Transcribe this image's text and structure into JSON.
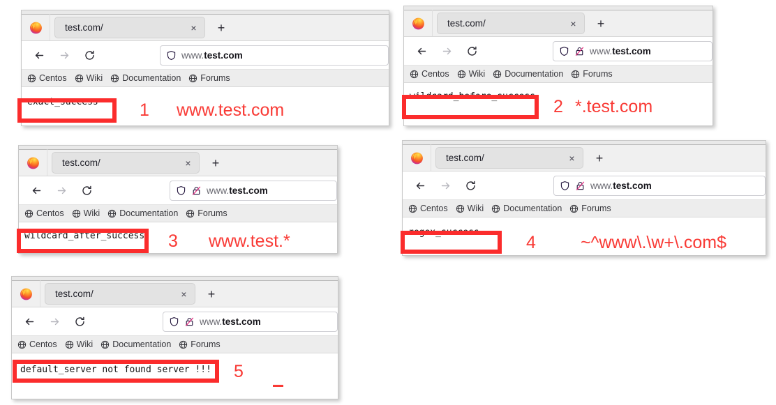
{
  "browser": {
    "tab_title": "test.com/",
    "tab_close_glyph": "×",
    "newtab_glyph": "+",
    "url_prefix": "www.",
    "url_host": "test.com",
    "bookmarks": [
      "Centos",
      "Wiki",
      "Documentation",
      "Forums"
    ]
  },
  "colors": {
    "annotation_red": "#f93a35",
    "box_red": "#fb2c2c",
    "chrome_bg": "#f0f0f0",
    "bookmarks_bg": "#ededed"
  },
  "panels": [
    {
      "id": "panel-1",
      "page_text": "exact_success",
      "number": "1",
      "annotation": "www.test.com",
      "has_lock_icon": false
    },
    {
      "id": "panel-2",
      "page_text": "wildcard_before_success",
      "number": "2",
      "annotation": "*.test.com",
      "has_lock_icon": true
    },
    {
      "id": "panel-3",
      "page_text": "wildcard_after_success",
      "number": "3",
      "annotation": "www.test.*",
      "has_lock_icon": true
    },
    {
      "id": "panel-4",
      "page_text": "regex_success",
      "number": "4",
      "annotation": "~^www\\.\\w+\\.com$",
      "has_lock_icon": true
    },
    {
      "id": "panel-5",
      "page_text": "default_server not found server !!!",
      "number": "5",
      "annotation": "",
      "has_lock_icon": true
    }
  ]
}
